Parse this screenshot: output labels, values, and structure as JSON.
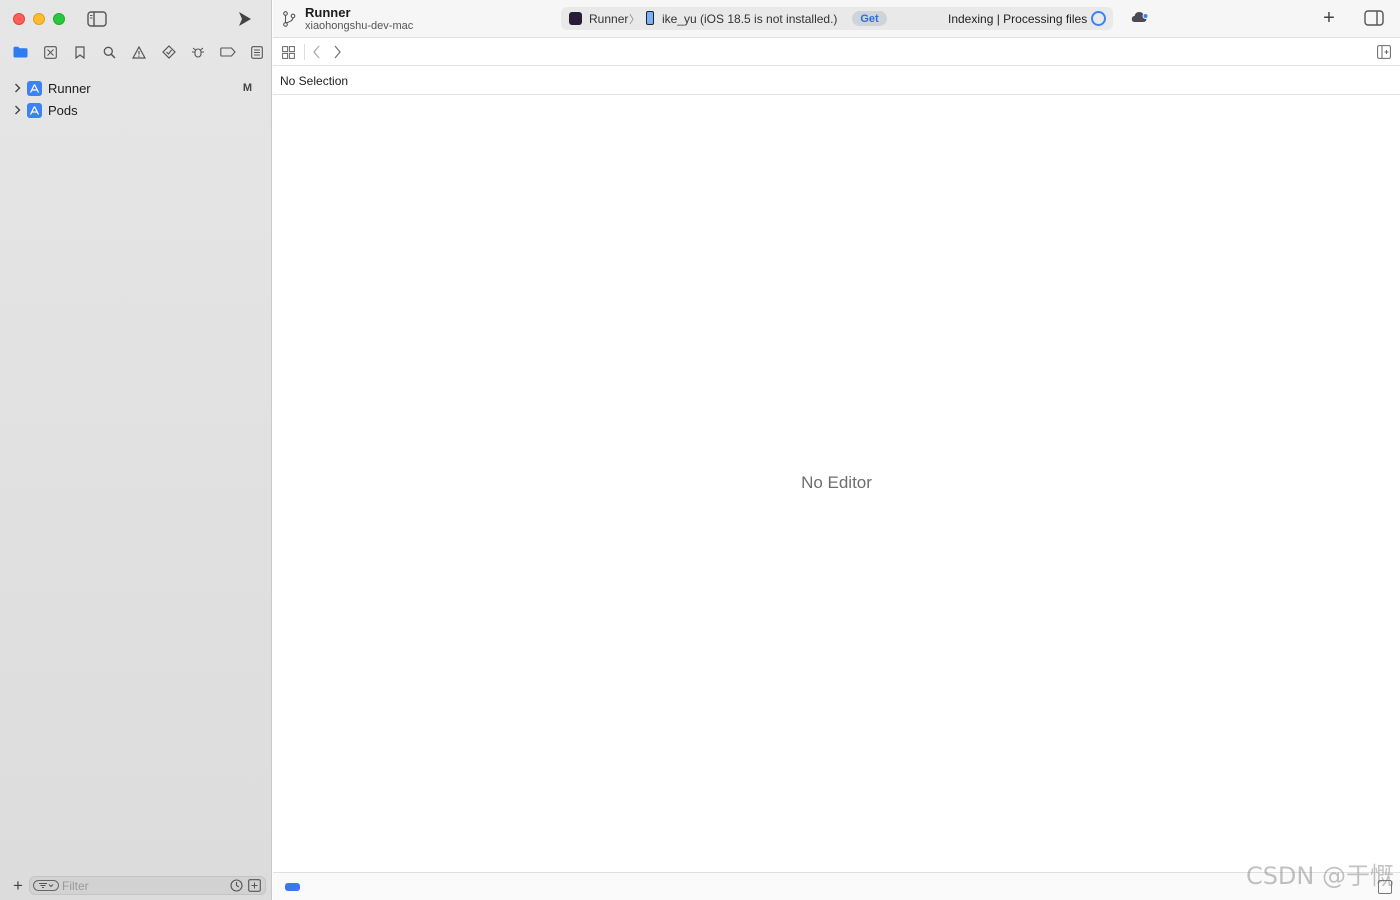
{
  "toolbar": {
    "project_name": "Runner",
    "branch_subtitle": "xiaohongshu-dev-mac",
    "scheme_label": "Runner",
    "device_label": "ike_yu (iOS 18.5 is not installed.)",
    "get_label": "Get",
    "status_text": "Indexing | Processing files"
  },
  "navigator": {
    "tabs": [
      "folder-icon",
      "source-control-icon",
      "bookmark-icon",
      "search-icon",
      "warning-icon",
      "test-icon",
      "debug-icon",
      "breakpoint-icon",
      "report-icon"
    ],
    "items": [
      {
        "label": "Runner",
        "badge": "M"
      },
      {
        "label": "Pods",
        "badge": ""
      }
    ],
    "filter_placeholder": "Filter"
  },
  "editor": {
    "breadcrumb": "No Selection",
    "empty_message": "No Editor"
  },
  "watermark": "CSDN @于慨",
  "colors": {
    "accent": "#3b82f6",
    "close": "#fe5f57",
    "minimize": "#febc2e",
    "zoom": "#28c840"
  }
}
